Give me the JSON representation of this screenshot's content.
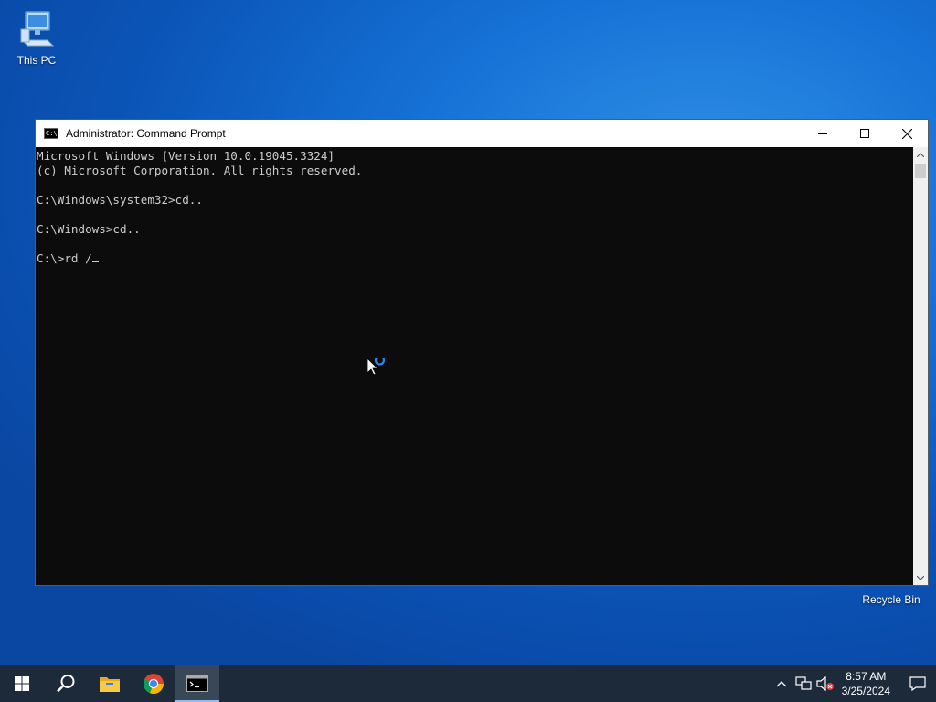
{
  "desktop": {
    "icons": [
      {
        "label": "This PC",
        "icon": "computer-icon"
      },
      {
        "label": "Recycle Bin",
        "icon": "recycle-bin-icon"
      }
    ]
  },
  "window": {
    "title": "Administrator: Command Prompt",
    "icon": "cmd-icon",
    "icon_text": "C:\\"
  },
  "console": {
    "lines": [
      "Microsoft Windows [Version 10.0.19045.3324]",
      "(c) Microsoft Corporation. All rights reserved.",
      "",
      "C:\\Windows\\system32>cd..",
      "",
      "C:\\Windows>cd..",
      "",
      "C:\\>rd /"
    ]
  },
  "taskbar": {
    "items": [
      "windows-start-icon",
      "search-icon",
      "file-explorer-icon",
      "chrome-icon",
      "cmd-icon"
    ],
    "active": "cmd-icon"
  },
  "tray": {
    "time": "8:57 AM",
    "date": "3/25/2024"
  },
  "colors": {
    "accent": "#0a5fc8",
    "taskbar": "#1c2a3a",
    "console_bg": "#0c0c0c",
    "console_fg": "#cccccc"
  }
}
